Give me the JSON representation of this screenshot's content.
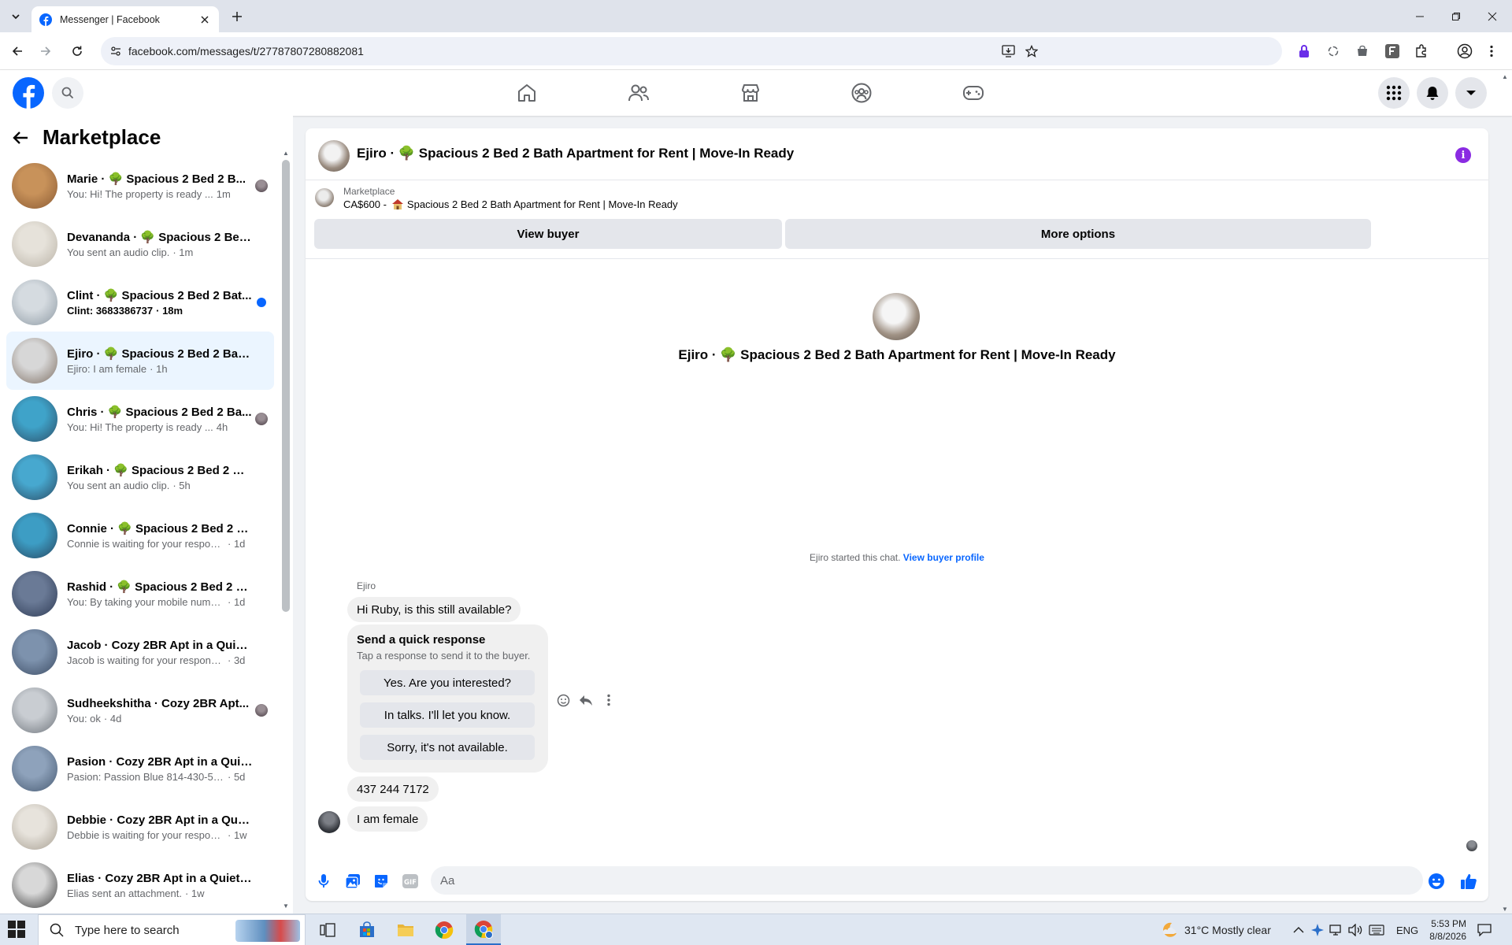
{
  "browser": {
    "tab_title": "Messenger | Facebook",
    "url": "facebook.com/messages/t/27787807280882081"
  },
  "sidebar": {
    "title": "Marketplace",
    "conversations": [
      {
        "name": "Marie · 🌳 Spacious 2 Bed 2 B...",
        "preview": "You: Hi! The property is ready ...",
        "time": "1m",
        "seen_avatar": true,
        "colors": [
          "#c8925a",
          "#8a5a33"
        ]
      },
      {
        "name": "Devananda · 🌳 Spacious 2 Bed ...",
        "preview": "You sent an audio clip.",
        "time": "· 1m",
        "colors": [
          "#e6e2da",
          "#b9b2a6"
        ]
      },
      {
        "name": "Clint · 🌳 Spacious 2 Bed 2 Bat...",
        "preview": "Clint: 3683386737",
        "time": "· 18m",
        "unread": true,
        "colors": [
          "#d5dbe0",
          "#8d99a3"
        ]
      },
      {
        "name": "Ejiro · 🌳 Spacious 2 Bed 2 Bath ...",
        "preview": "Ejiro: I am female",
        "time": "· 1h",
        "active": true,
        "colors": [
          "#d7d7d7",
          "#7e6f63"
        ]
      },
      {
        "name": "Chris · 🌳 Spacious 2 Bed 2 Ba...",
        "preview": "You: Hi! The property is ready ...",
        "time": "4h",
        "seen_avatar": true,
        "colors": [
          "#3fa3c9",
          "#2c4e68"
        ]
      },
      {
        "name": "Erikah · 🌳 Spacious 2 Bed 2 Bat...",
        "preview": "You sent an audio clip.",
        "time": "· 5h",
        "colors": [
          "#47a8cf",
          "#2a4a63"
        ]
      },
      {
        "name": "Connie · 🌳 Spacious 2 Bed 2 Ba...",
        "preview": "Connie is waiting for your response.",
        "time": "· 1d",
        "colors": [
          "#3d9dc4",
          "#274660"
        ]
      },
      {
        "name": "Rashid · 🌳 Spacious 2 Bed 2 Bat...",
        "preview": "You: By taking your mobile number...",
        "time": "· 1d",
        "colors": [
          "#6a7a96",
          "#2e3b55"
        ]
      },
      {
        "name": "Jacob · Cozy 2BR Apt in a Quiet ...",
        "preview": "Jacob is waiting for your response.",
        "time": "· 3d",
        "colors": [
          "#7d92ad",
          "#3c4c64"
        ]
      },
      {
        "name": "Sudheekshitha · Cozy 2BR Apt...",
        "preview": "You: ok",
        "time": "· 4d",
        "seen_avatar": true,
        "colors": [
          "#c9cdd2",
          "#6e747b"
        ]
      },
      {
        "name": "Pasion · Cozy 2BR Apt in a Quiet...",
        "preview": "Pasion: Passion Blue 814-430-5824",
        "time": "· 5d",
        "colors": [
          "#8ea2bb",
          "#475a72"
        ]
      },
      {
        "name": "Debbie · Cozy 2BR Apt in a Quie...",
        "preview": "Debbie is waiting for your response.",
        "time": "· 1w",
        "colors": [
          "#e7e3dc",
          "#a79f92"
        ]
      },
      {
        "name": "Elias · Cozy 2BR Apt in a Quiet A...",
        "preview": "Elias sent an attachment.",
        "time": "· 1w",
        "colors": [
          "#d8d8d8",
          "#3a3a3a"
        ]
      }
    ]
  },
  "chat": {
    "title": "Ejiro · 🌳 Spacious 2 Bed 2 Bath Apartment for Rent | Move-In Ready",
    "listing_label": "Marketplace",
    "listing_price": "CA$600 -",
    "listing_name": "Spacious 2 Bed 2 Bath Apartment for Rent | Move-In Ready",
    "view_buyer": "View buyer",
    "more_options": "More options",
    "intro_title": "Ejiro · 🌳 Spacious 2 Bed 2 Bath Apartment for Rent | Move-In Ready",
    "started_text": "Ejiro started this chat.",
    "view_profile": "View buyer profile",
    "sender": "Ejiro",
    "msg1": "Hi Ruby, is this still available?",
    "quick_title": "Send a quick response",
    "quick_sub": "Tap a response to send it to the buyer.",
    "quick_options": [
      "Yes. Are you interested?",
      "In talks. I'll let you know.",
      "Sorry, it's not available."
    ],
    "msg2": "437 244 7172",
    "msg3": "I am female",
    "composer_placeholder": "Aa"
  },
  "taskbar": {
    "search_placeholder": "Type here to search",
    "weather": "31°C  Mostly clear",
    "lang": "ENG",
    "time": "5:53 PM",
    "date": "8/8/2026"
  },
  "colors": {
    "fb_blue": "#0866ff",
    "active_conv": "#ebf5ff",
    "info_purple": "#8a2be2"
  }
}
